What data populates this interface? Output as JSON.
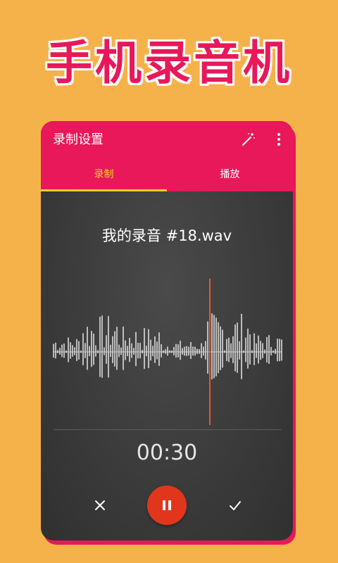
{
  "banner": {
    "title": "手机录音机"
  },
  "appbar": {
    "title": "录制设置"
  },
  "tabs": [
    {
      "label": "录制",
      "active": true
    },
    {
      "label": "播放",
      "active": false
    }
  ],
  "recording": {
    "file_name": "我的录音 #18.wav",
    "elapsed": "00:30"
  },
  "colors": {
    "background": "#F6B24A",
    "accent": "#E8185A",
    "tab_active": "#FFD12A",
    "record_button": "#E2361C",
    "playhead": "#E05A2B"
  },
  "icons": {
    "wand": "magic-wand-icon",
    "more": "more-vertical-icon",
    "cancel": "close-icon",
    "pause": "pause-icon",
    "confirm": "check-icon"
  }
}
